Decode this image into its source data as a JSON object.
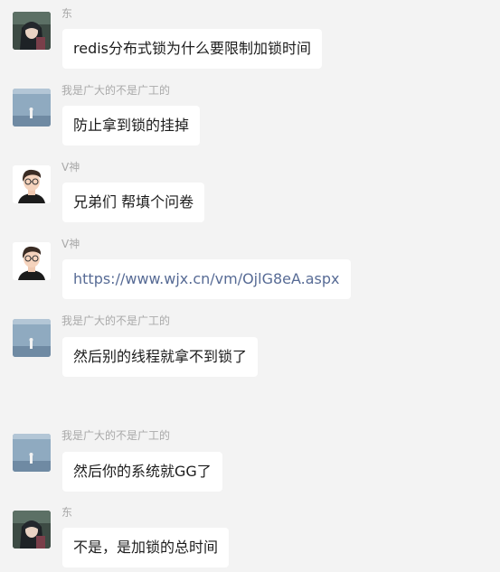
{
  "messages": [
    {
      "sender": "东",
      "avatar": "anime-avatar",
      "text": "redis分布式锁为什么要限制加锁时间",
      "kind": "text"
    },
    {
      "sender": "我是广大的不是广工的",
      "avatar": "lake-avatar",
      "text": "防止拿到锁的挂掉",
      "kind": "text"
    },
    {
      "sender": "V神",
      "avatar": "man-avatar",
      "text": "兄弟们  帮填个问卷",
      "kind": "text"
    },
    {
      "sender": "V神",
      "avatar": "man-avatar",
      "text": "https://www.wjx.cn/vm/OjlG8eA.aspx",
      "kind": "link"
    },
    {
      "sender": "我是广大的不是广工的",
      "avatar": "lake-avatar",
      "text": "然后别的线程就拿不到锁了",
      "kind": "text"
    },
    {
      "sender": "我是广大的不是广工的",
      "avatar": "lake-avatar",
      "text": "然后你的系统就GG了",
      "kind": "text"
    },
    {
      "sender": "东",
      "avatar": "anime-avatar",
      "text": "不是，是加锁的总时间",
      "kind": "text"
    }
  ],
  "colors": {
    "background": "#f3f3f3",
    "bubble": "#ffffff",
    "sender_name": "#a9a9a9",
    "link": "#576b95"
  }
}
